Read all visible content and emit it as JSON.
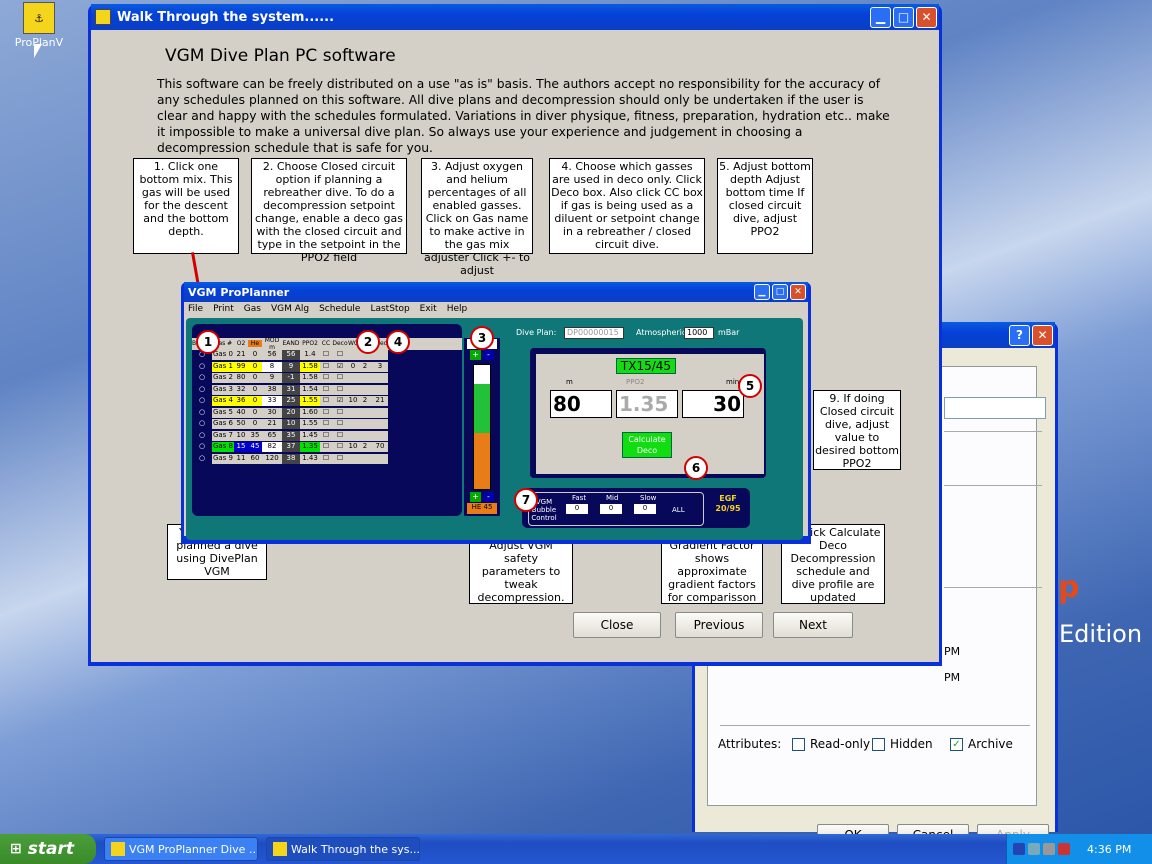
{
  "desktop": {
    "icon_label": "ProPlanV"
  },
  "walk": {
    "title": "Walk Through the system......",
    "heading": "VGM Dive Plan PC software",
    "intro": "This software can be freely distributed on a use \"as is\" basis. The authors accept no responsibility for the accuracy of any schedules planned on this software. All dive plans and decompression should only be undertaken if the user is clear and happy with the schedules formulated. Variations in diver physique, fitness, preparation, hydration etc.. make it impossible to make a universal dive plan. So always use your experience and judgement in choosing a decompression schedule that is safe for you.",
    "notes": {
      "n1": "1. Click one bottom mix. This gas will be used for the descent and the bottom depth.",
      "n2": "2. Choose Closed circuit option if planning a rebreather dive. To do a decompression setpoint change, enable a deco gas with the closed circuit and type in the setpoint in the PPO2 field",
      "n3": "3. Adjust oxygen and helium percentages of all enabled gasses. Click on Gas name to make active in the gas mix adjuster Click +- to adjust",
      "n4": "4. Choose which gasses are used in deco only. Click Deco box. Also click CC box if gas is being used as a diluent or setpoint change in a rebreather / closed circuit dive.",
      "n5": "5. Adjust bottom depth Adjust bottom time If closed circuit dive, adjust PPO2",
      "n9": "9. If doing Closed circuit dive, adjust value to desired bottom PPO2",
      "n_done": "You have now planned a dive using DivePlan VGM",
      "n7": "7. If required, Adjust VGM safety parameters to tweak decompression.",
      "n_egf": "Equivalent Gradient Factor shows approximate gradient factors for comparisson",
      "n6": "6. Click Calculate Deco Decompression schedule and dive profile are updated"
    },
    "buttons": {
      "close": "Close",
      "previous": "Previous",
      "next": "Next"
    }
  },
  "proplanner": {
    "title": "VGM ProPlanner",
    "menu": [
      "File",
      "Print",
      "Gas",
      "VGM Alg",
      "Schedule",
      "LastStop",
      "Exit",
      "Help"
    ],
    "headers": [
      "Bottom",
      "Gas #",
      "O2",
      "He",
      "MOD m",
      "EAND",
      "PPO2",
      "CC",
      "Deco",
      "WC",
      "SAC",
      "Used"
    ],
    "gases": [
      {
        "name": "Gas 0",
        "o2": "21",
        "he": "0",
        "mod": "56",
        "eand": "56",
        "ppo2": "1.4",
        "deco": false,
        "wc": "",
        "sac": "",
        "used": "",
        "hl": ""
      },
      {
        "name": "Gas 1",
        "o2": "99",
        "he": "0",
        "mod": "8",
        "eand": "9",
        "ppo2": "1.58",
        "deco": true,
        "wc": "0",
        "sac": "2",
        "used": "3",
        "hl": "y"
      },
      {
        "name": "Gas 2",
        "o2": "80",
        "he": "0",
        "mod": "9",
        "eand": "-1",
        "ppo2": "1.58",
        "deco": false,
        "wc": "",
        "sac": "",
        "used": "",
        "hl": ""
      },
      {
        "name": "Gas 3",
        "o2": "32",
        "he": "0",
        "mod": "38",
        "eand": "31",
        "ppo2": "1.54",
        "deco": false,
        "wc": "",
        "sac": "",
        "used": "",
        "hl": ""
      },
      {
        "name": "Gas 4",
        "o2": "36",
        "he": "0",
        "mod": "33",
        "eand": "25",
        "ppo2": "1.55",
        "deco": true,
        "wc": "10",
        "sac": "2",
        "used": "21",
        "hl": "y"
      },
      {
        "name": "Gas 5",
        "o2": "40",
        "he": "0",
        "mod": "30",
        "eand": "20",
        "ppo2": "1.60",
        "deco": false,
        "wc": "",
        "sac": "",
        "used": "",
        "hl": ""
      },
      {
        "name": "Gas 6",
        "o2": "50",
        "he": "0",
        "mod": "21",
        "eand": "10",
        "ppo2": "1.55",
        "deco": false,
        "wc": "",
        "sac": "",
        "used": "",
        "hl": ""
      },
      {
        "name": "Gas 7",
        "o2": "10",
        "he": "35",
        "mod": "65",
        "eand": "35",
        "ppo2": "1.45",
        "deco": false,
        "wc": "",
        "sac": "",
        "used": "",
        "hl": ""
      },
      {
        "name": "Gas 8",
        "o2": "15",
        "he": "45",
        "mod": "82",
        "eand": "37",
        "ppo2": "1.35",
        "deco": false,
        "wc": "10",
        "sac": "2",
        "used": "70",
        "hl": "g"
      },
      {
        "name": "Gas 9",
        "o2": "11",
        "he": "60",
        "mod": "120",
        "eand": "38",
        "ppo2": "1.43",
        "deco": false,
        "wc": "",
        "sac": "",
        "used": "",
        "hl": ""
      }
    ],
    "mix_top": "O2 15",
    "mix_bottom": "HE 45",
    "mix_o2_fraction": 0.15,
    "mix_he_fraction": 0.45,
    "dive_plan_label": "Dive Plan:",
    "dive_plan_value": "DP00000015",
    "atmos_label": "Atmospheric",
    "atmos_value": "1000",
    "atmos_unit": "mBar",
    "gas_name": "TX15/45",
    "depth": "80",
    "depth_unit": "m",
    "ppo2": "1.35",
    "ppo2_label": "PPO2",
    "time": "30",
    "time_unit": "mins",
    "calc_label": "Calculate Deco",
    "vgm_label": "VGM Bubble Control",
    "fast_label": "Fast",
    "fast_value": "0",
    "med_label": "Mid",
    "med_value": "0",
    "slow_label": "Slow",
    "slow_value": "0",
    "all_label": "ALL",
    "egf_label": "EGF",
    "egf_value": "20/95"
  },
  "badges": [
    "1",
    "2",
    "4",
    "3",
    "5",
    "6",
    "7"
  ],
  "props": {
    "edition_text": "Edition",
    "p_letter": "p",
    "pm1": "PM",
    "pm2": "PM",
    "attributes_label": "Attributes:",
    "readonly": "Read-only",
    "hidden": "Hidden",
    "archive": "Archive",
    "ok": "OK",
    "cancel": "Cancel",
    "apply": "Apply"
  },
  "taskbar": {
    "start": "start",
    "task1": "VGM ProPlanner Dive ...",
    "task2": "Walk Through the sys....",
    "clock": "4:36 PM"
  },
  "colors": {
    "teal": "#0f7778",
    "navy": "#08085a",
    "xp_blue": "#0831d9",
    "yellow_hl": "#ffff00",
    "green_hl": "#00e000",
    "badge_red": "#d10000"
  }
}
